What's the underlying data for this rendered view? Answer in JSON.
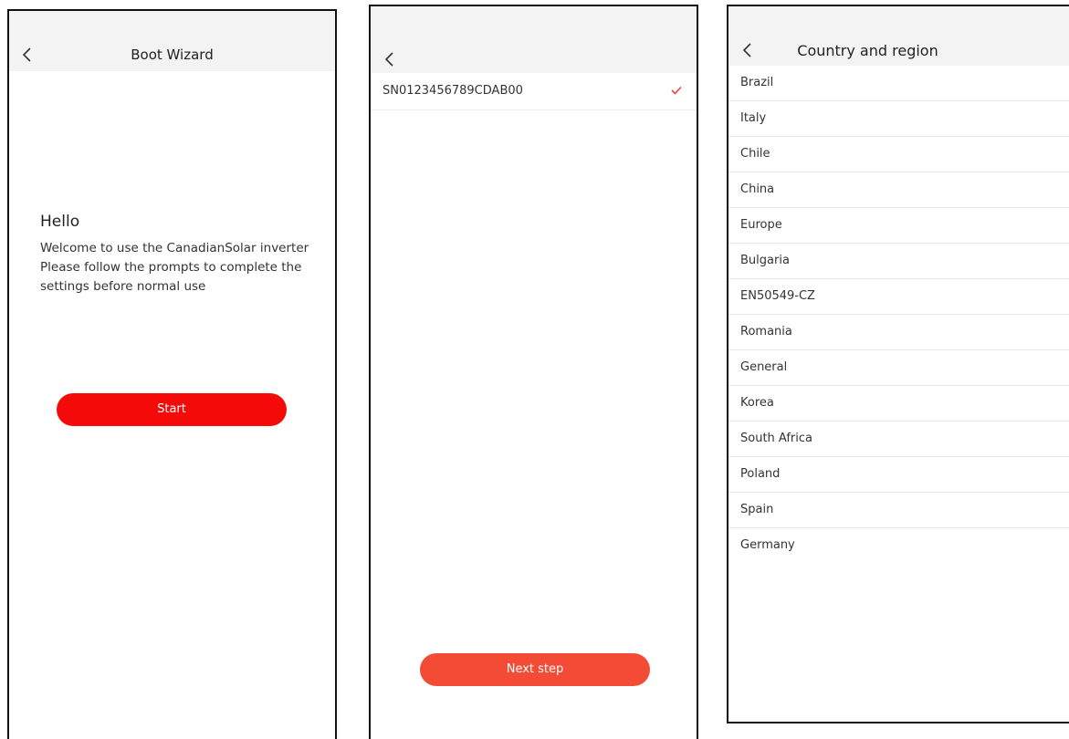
{
  "colors": {
    "start_button": "#f50a0a",
    "next_button": "#f34b36",
    "check_mark": "#e8453c",
    "header_background": "#f3f3f3"
  },
  "screen1": {
    "header": {
      "back_icon": "chevron-left-icon",
      "title": "Boot Wizard"
    },
    "greeting": "Hello",
    "welcome_lines": [
      "Welcome to use the CanadianSolar inverter",
      "Please follow the prompts to complete the settings before normal use"
    ],
    "start_label": "Start"
  },
  "screen2": {
    "header": {
      "back_icon": "chevron-left-icon"
    },
    "devices": [
      {
        "serial": "SN0123456789CDAB00",
        "selected": true,
        "icon": "check-icon"
      }
    ],
    "next_label": "Next step"
  },
  "screen3": {
    "header": {
      "back_icon": "chevron-left-icon",
      "title": "Country and region"
    },
    "countries": [
      "Brazil",
      "Italy",
      "Chile",
      "China",
      "Europe",
      "Bulgaria",
      "EN50549-CZ",
      "Romania",
      "General",
      "Korea",
      "South Africa",
      "Poland",
      "Spain",
      "Germany"
    ]
  }
}
